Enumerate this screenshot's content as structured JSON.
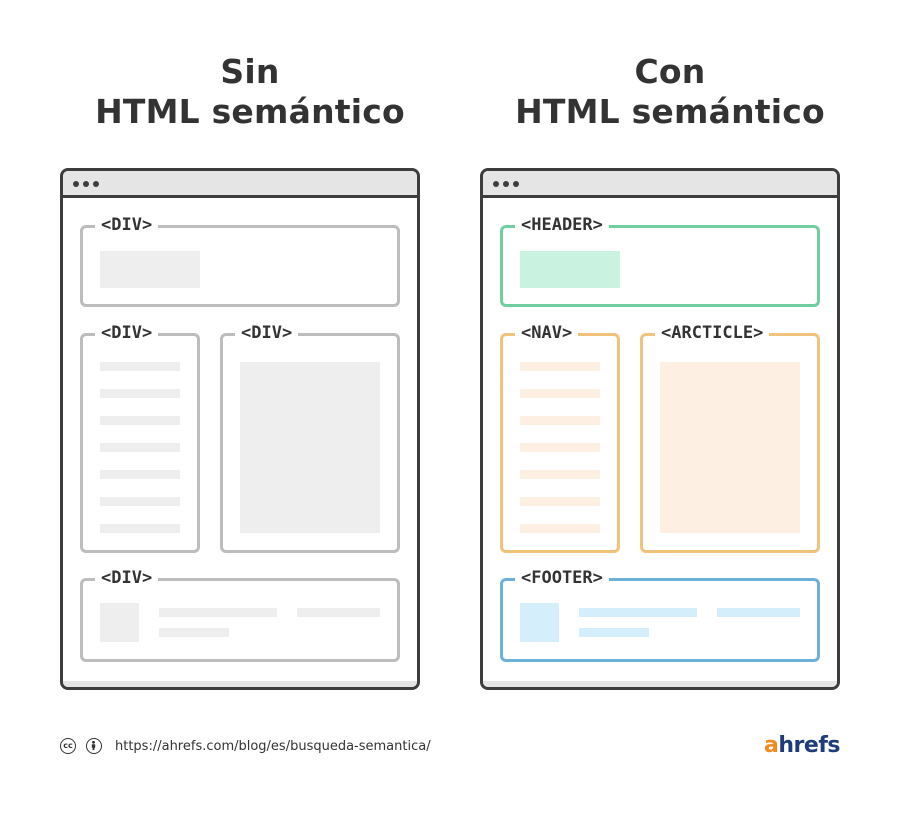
{
  "left_panel": {
    "title_line1": "Sin",
    "title_line2": "HTML semántico",
    "labels": {
      "header": "<DIV>",
      "nav": "<DIV>",
      "article": "<DIV>",
      "footer": "<DIV>"
    }
  },
  "right_panel": {
    "title_line1": "Con",
    "title_line2": "HTML semántico",
    "labels": {
      "header": "<HEADER>",
      "nav": "<NAV>",
      "article": "<ARCTICLE>",
      "footer": "<FOOTER>"
    }
  },
  "colors": {
    "neutral_border": "#bdbdbd",
    "neutral_fill": "#eeeeee",
    "header_border": "#6fcf9f",
    "header_fill": "#c9f3e0",
    "nav_article_border": "#f0c27a",
    "nav_article_fill": "#fdf0e3",
    "footer_border": "#6cb1d8",
    "footer_fill": "#d4eefb",
    "logo_a": "#f28a1e",
    "logo_rest": "#1f3c7a"
  },
  "footer": {
    "url": "https://ahrefs.com/blog/es/busqueda-semantica/",
    "cc_icon_text": "cc",
    "logo_a": "a",
    "logo_rest": "hrefs"
  }
}
